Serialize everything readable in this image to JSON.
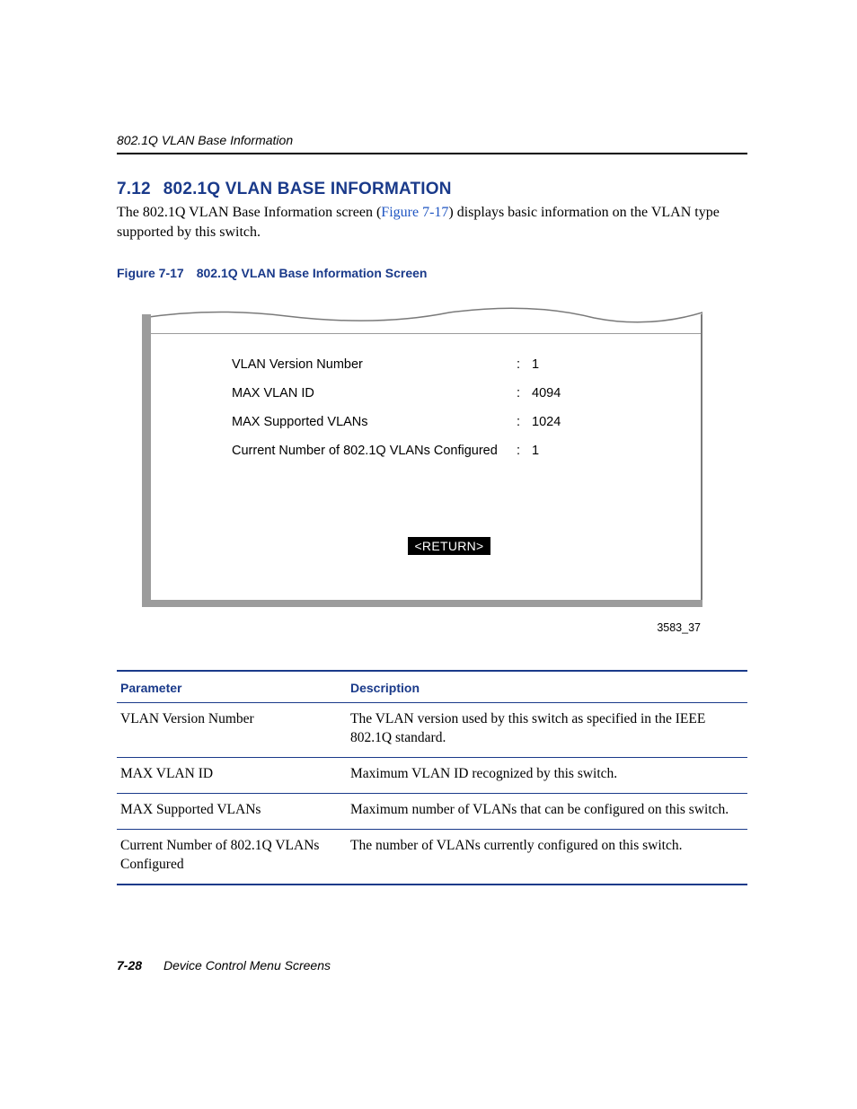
{
  "running_head": "802.1Q VLAN Base Information",
  "section": {
    "number": "7.12",
    "title": "802.1Q VLAN BASE INFORMATION"
  },
  "paragraph": {
    "pre": "The 802.1Q VLAN Base Information screen (",
    "link": "Figure 7-17",
    "post": ") displays basic information on the VLAN type supported by this switch."
  },
  "figure": {
    "number": "Figure 7-17",
    "caption": "802.1Q VLAN Base Information Screen",
    "id": "3583_37"
  },
  "screen": {
    "rows": [
      {
        "label": "VLAN Version Number",
        "value": "1"
      },
      {
        "label": "MAX VLAN ID",
        "value": "4094"
      },
      {
        "label": "MAX Supported VLANs",
        "value": "1024"
      },
      {
        "label": "Current Number of 802.1Q VLANs Configured",
        "value": "1"
      }
    ],
    "return_label": "<RETURN>"
  },
  "table": {
    "headers": {
      "param": "Parameter",
      "desc": "Description"
    },
    "rows": [
      {
        "param": "VLAN Version Number",
        "desc": "The VLAN version used by this switch as specified in the IEEE 802.1Q standard."
      },
      {
        "param": "MAX VLAN ID",
        "desc": "Maximum VLAN ID recognized by this switch."
      },
      {
        "param": "MAX Supported VLANs",
        "desc": "Maximum number of VLANs that can be configured on this switch."
      },
      {
        "param": "Current Number of 802.1Q VLANs Configured",
        "desc": "The number of VLANs currently configured on this switch."
      }
    ]
  },
  "footer": {
    "page": "7-28",
    "chapter": "Device Control Menu Screens"
  }
}
